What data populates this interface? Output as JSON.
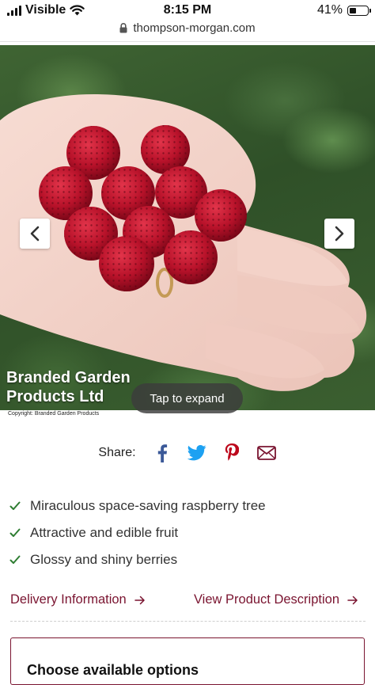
{
  "status_bar": {
    "carrier": "Visible",
    "time": "8:15 PM",
    "battery_percent": "41%",
    "battery_level": 0.41
  },
  "url_bar": {
    "domain": "thompson-morgan.com"
  },
  "gallery": {
    "watermark_line1": "Branded Garden",
    "watermark_line2": "Products Ltd",
    "copyright": "Copyright: Branded Garden Products",
    "tap_to_expand": "Tap to expand"
  },
  "share": {
    "label": "Share:",
    "icons": [
      "facebook-icon",
      "twitter-icon",
      "pinterest-icon",
      "email-icon"
    ],
    "colors": {
      "facebook": "#3b5998",
      "twitter": "#1da1f2",
      "pinterest": "#bd081c",
      "email": "#7a1430"
    }
  },
  "features": [
    "Miraculous space-saving raspberry tree",
    "Attractive and edible fruit",
    "Glossy and shiny berries"
  ],
  "links": {
    "delivery": "Delivery Information",
    "description": "View Product Description"
  },
  "options_box": {
    "title": "Choose available options"
  },
  "colors": {
    "brand": "#7a1430",
    "check": "#2e7d32"
  }
}
